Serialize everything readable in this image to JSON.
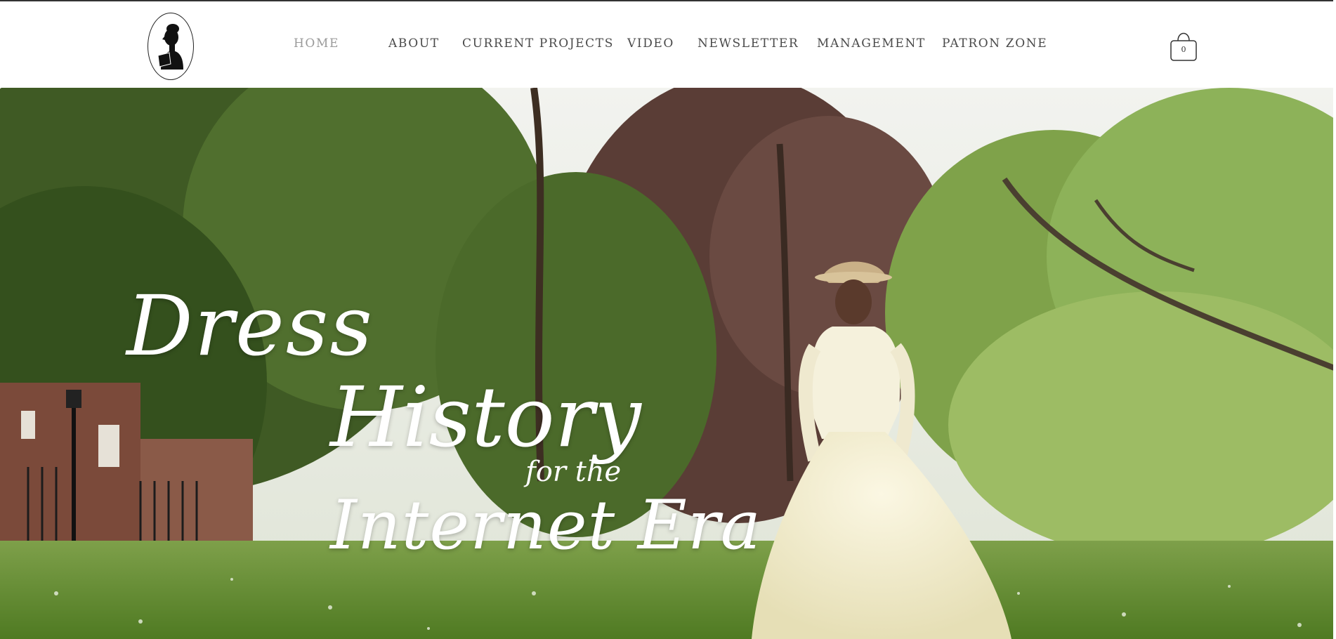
{
  "nav": {
    "items": [
      {
        "label": "HOME",
        "active": true
      },
      {
        "label": "ABOUT",
        "active": false
      },
      {
        "label": "CURRENT PROJECTS",
        "active": false
      },
      {
        "label": "VIDEO",
        "active": false
      },
      {
        "label": "NEWSLETTER",
        "active": false
      },
      {
        "label": "MANAGEMENT",
        "active": false
      },
      {
        "label": "PATRON ZONE",
        "active": false
      }
    ]
  },
  "cart": {
    "count": "0",
    "icon": "shopping-bag-icon"
  },
  "logo": {
    "icon": "silhouette-portrait-icon"
  },
  "hero": {
    "title_line1": "Dress",
    "title_line2": "History",
    "title_line3": "for the",
    "title_line4": "Internet Era"
  },
  "colors": {
    "nav_text": "#4a4a4a",
    "nav_active": "#9a9a9a",
    "hero_text": "#ffffff"
  }
}
